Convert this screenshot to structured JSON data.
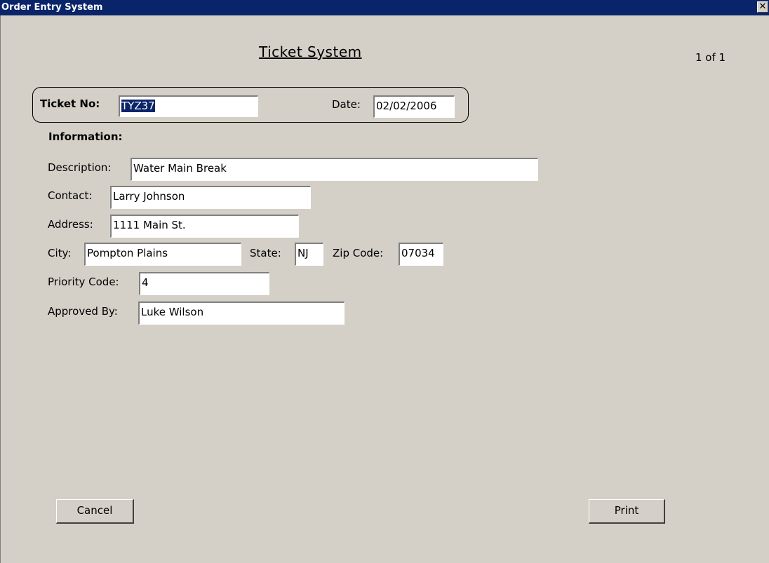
{
  "window": {
    "title": "Order Entry System",
    "close_glyph": "✕"
  },
  "form": {
    "heading": "Ticket System",
    "page_count": "1 of 1",
    "ticket_no_label": "Ticket No:",
    "ticket_no_value": "TYZ37",
    "date_label": "Date:",
    "date_value": "02/02/2006",
    "section_label": "Information:",
    "description_label": "Description:",
    "description_value": "Water Main Break",
    "contact_label": "Contact:",
    "contact_value": "Larry Johnson",
    "address_label": "Address:",
    "address_value": "1111 Main St.",
    "city_label": "City:",
    "city_value": "Pompton Plains",
    "state_label": "State:",
    "state_value": "NJ",
    "zip_label": "Zip Code:",
    "zip_value": "07034",
    "priority_label": "Priority Code:",
    "priority_value": "4",
    "approved_label": "Approved By:",
    "approved_value": "Luke Wilson"
  },
  "buttons": {
    "cancel": "Cancel",
    "print": "Print"
  },
  "colors": {
    "titlebar": "#0a246a",
    "background": "#d4d0c8",
    "selection": "#0a246a"
  }
}
